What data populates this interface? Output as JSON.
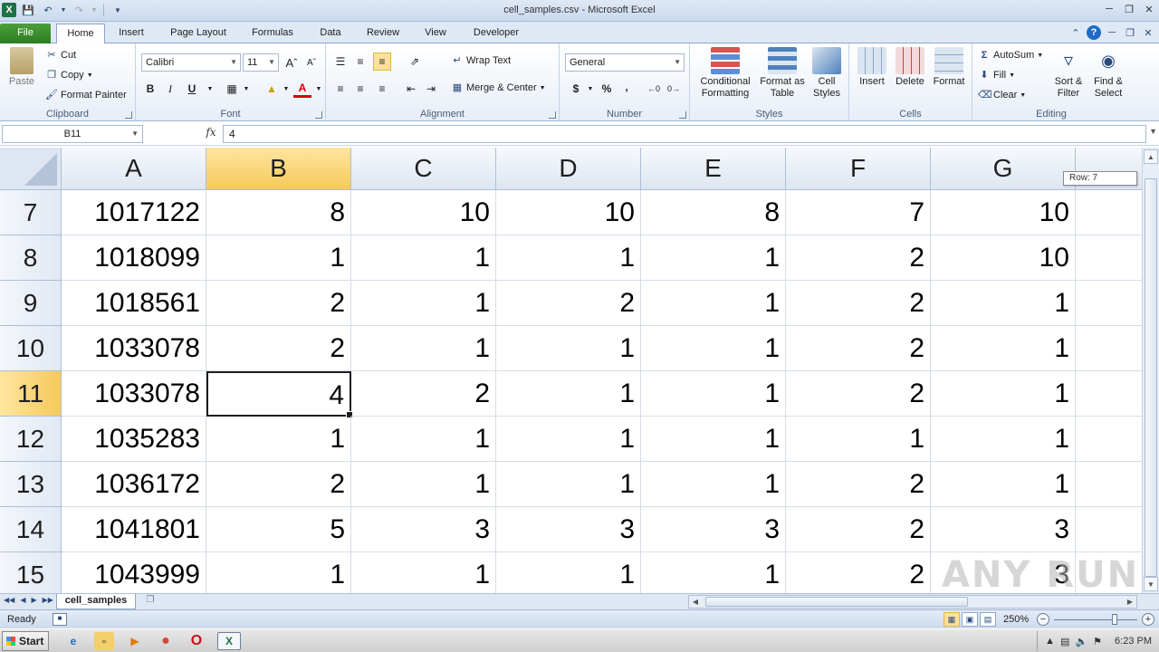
{
  "window": {
    "title": "cell_samples.csv - Microsoft Excel"
  },
  "tabs": [
    {
      "label": "File"
    },
    {
      "label": "Home"
    },
    {
      "label": "Insert"
    },
    {
      "label": "Page Layout"
    },
    {
      "label": "Formulas"
    },
    {
      "label": "Data"
    },
    {
      "label": "Review"
    },
    {
      "label": "View"
    },
    {
      "label": "Developer"
    }
  ],
  "ribbon": {
    "clipboard": {
      "label": "Clipboard",
      "paste": "Paste",
      "cut": "Cut",
      "copy": "Copy",
      "format_painter": "Format Painter"
    },
    "font": {
      "label": "Font",
      "name": "Calibri",
      "size": "11",
      "bold": "B",
      "italic": "I",
      "underline": "U"
    },
    "alignment": {
      "label": "Alignment",
      "wrap_text": "Wrap Text",
      "merge_center": "Merge & Center"
    },
    "number": {
      "label": "Number",
      "format": "General",
      "currency": "$",
      "percent": "%",
      "comma": ","
    },
    "styles": {
      "label": "Styles",
      "conditional": "Conditional Formatting",
      "format_table": "Format as Table",
      "cell_styles": "Cell Styles"
    },
    "cells": {
      "label": "Cells",
      "insert": "Insert",
      "delete": "Delete",
      "format": "Format"
    },
    "editing": {
      "label": "Editing",
      "autosum": "AutoSum",
      "fill": "Fill",
      "clear": "Clear",
      "sort_filter": "Sort & Filter",
      "find_select": "Find & Select"
    }
  },
  "formula_bar": {
    "name_box": "B11",
    "fx": "fx",
    "value": "4"
  },
  "grid": {
    "columns": [
      "A",
      "B",
      "C",
      "D",
      "E",
      "F",
      "G"
    ],
    "selected_column": "B",
    "selected_row": "11",
    "rows": [
      {
        "num": "7",
        "cells": [
          "1017122",
          "8",
          "10",
          "10",
          "8",
          "7",
          "10"
        ]
      },
      {
        "num": "8",
        "cells": [
          "1018099",
          "1",
          "1",
          "1",
          "1",
          "2",
          "10"
        ]
      },
      {
        "num": "9",
        "cells": [
          "1018561",
          "2",
          "1",
          "2",
          "1",
          "2",
          "1"
        ]
      },
      {
        "num": "10",
        "cells": [
          "1033078",
          "2",
          "1",
          "1",
          "1",
          "2",
          "1"
        ]
      },
      {
        "num": "11",
        "cells": [
          "1033078",
          "4",
          "2",
          "1",
          "1",
          "2",
          "1"
        ]
      },
      {
        "num": "12",
        "cells": [
          "1035283",
          "1",
          "1",
          "1",
          "1",
          "1",
          "1"
        ]
      },
      {
        "num": "13",
        "cells": [
          "1036172",
          "2",
          "1",
          "1",
          "1",
          "2",
          "1"
        ]
      },
      {
        "num": "14",
        "cells": [
          "1041801",
          "5",
          "3",
          "3",
          "3",
          "2",
          "3"
        ]
      },
      {
        "num": "15",
        "cells": [
          "1043999",
          "1",
          "1",
          "1",
          "1",
          "2",
          "3"
        ]
      }
    ],
    "row_tooltip": "Row: 7"
  },
  "sheet": {
    "tab_label": "cell_samples"
  },
  "status": {
    "mode": "Ready",
    "zoom": "250%"
  },
  "taskbar": {
    "start": "Start",
    "clock": "6:23 PM"
  },
  "watermark": "ANY RUN"
}
